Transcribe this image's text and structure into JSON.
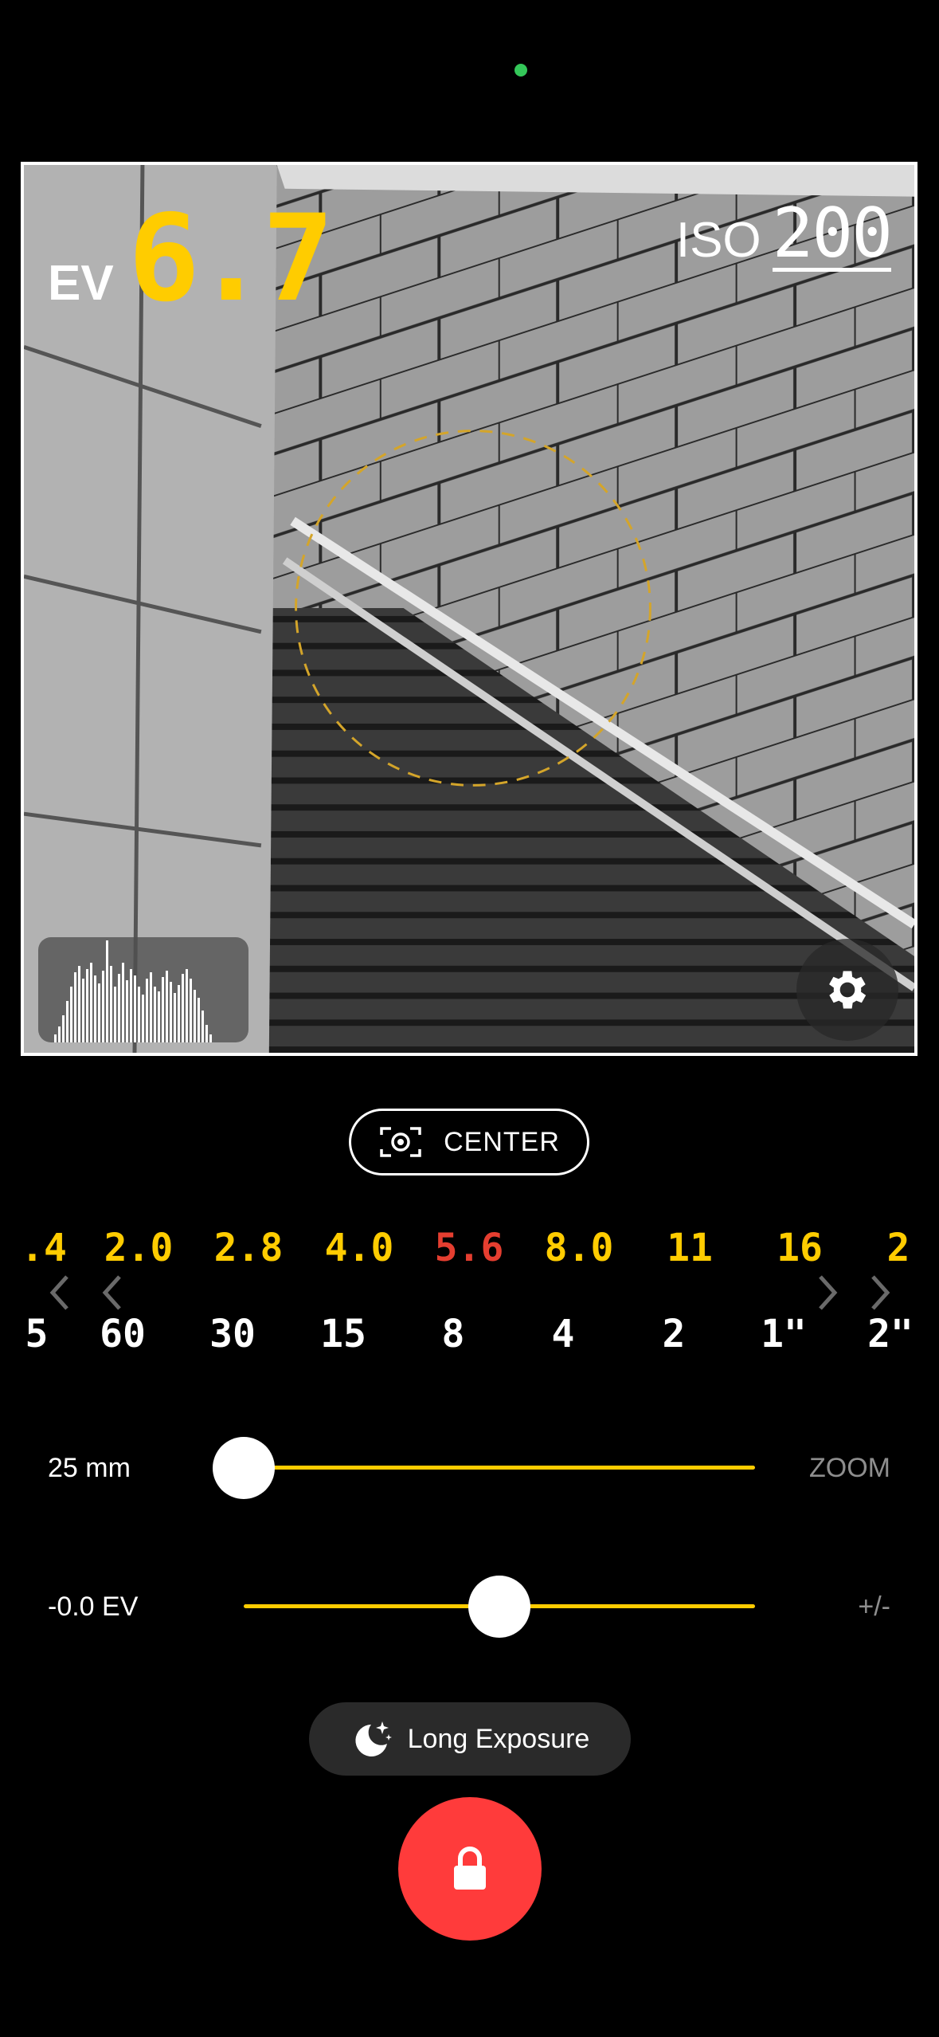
{
  "meter": {
    "ev_label": "EV",
    "ev_value": "6.7",
    "iso_label": "ISO",
    "iso_value": "200"
  },
  "metering": {
    "mode_label": "CENTER"
  },
  "aperture_dial": {
    "values": [
      ".4",
      "2.0",
      "2.8",
      "4.0",
      "5.6",
      "8.0",
      "11",
      "16",
      "2"
    ],
    "selected": "5.6"
  },
  "shutter_dial": {
    "values": [
      "5",
      "60",
      "30",
      "15",
      "8",
      "4",
      "2",
      "1\"",
      "2\""
    ]
  },
  "zoom_slider": {
    "value_label": "25 mm",
    "suffix": "ZOOM",
    "level": 0
  },
  "ev_slider": {
    "value_label": "-0.0 EV",
    "suffix": "+/-",
    "level": 0.5
  },
  "long_exposure": {
    "label": "Long Exposure"
  },
  "colors": {
    "accent": "#ffcc00",
    "selected_aperture": "#e53e30",
    "lock_button": "#ff3b3b",
    "camera_indicator": "#34c759"
  },
  "icons": {
    "settings": "gear-icon",
    "metering": "spot-metering-icon",
    "long_exposure": "moon-stars-icon",
    "lock": "lock-icon",
    "dial_prev": "chevron-left-icon",
    "dial_next": "chevron-right-icon"
  }
}
